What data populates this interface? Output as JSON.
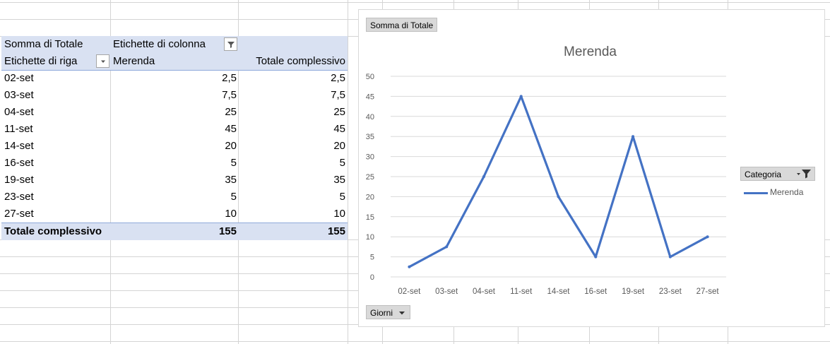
{
  "pivot": {
    "value_field": "Somma di Totale",
    "column_labels": "Etichette di colonna",
    "row_labels": "Etichette di riga",
    "series_header": "Merenda",
    "grand_total_header": "Totale complessivo",
    "rows": [
      {
        "label": "02-set",
        "merenda": "2,5",
        "total": "2,5"
      },
      {
        "label": "03-set",
        "merenda": "7,5",
        "total": "7,5"
      },
      {
        "label": "04-set",
        "merenda": "25",
        "total": "25"
      },
      {
        "label": "11-set",
        "merenda": "45",
        "total": "45"
      },
      {
        "label": "14-set",
        "merenda": "20",
        "total": "20"
      },
      {
        "label": "16-set",
        "merenda": "5",
        "total": "5"
      },
      {
        "label": "19-set",
        "merenda": "35",
        "total": "35"
      },
      {
        "label": "23-set",
        "merenda": "5",
        "total": "5"
      },
      {
        "label": "27-set",
        "merenda": "10",
        "total": "10"
      }
    ],
    "total_row": {
      "label": "Totale complessivo",
      "merenda": "155",
      "total": "155"
    }
  },
  "chart_controls": {
    "value_button": "Somma di Totale",
    "axis_button": "Giorni",
    "legend_button": "Categoria"
  },
  "chart_data": {
    "type": "line",
    "title": "Merenda",
    "categories": [
      "02-set",
      "03-set",
      "04-set",
      "11-set",
      "14-set",
      "16-set",
      "19-set",
      "23-set",
      "27-set"
    ],
    "series": [
      {
        "name": "Merenda",
        "values": [
          2.5,
          7.5,
          25,
          45,
          20,
          5,
          35,
          5,
          10
        ],
        "color": "#4472c4"
      }
    ],
    "ylim": [
      0,
      50
    ],
    "yticks": [
      "0",
      "5",
      "10",
      "15",
      "20",
      "25",
      "30",
      "35",
      "40",
      "45",
      "50"
    ],
    "grid": true,
    "legend": "right"
  },
  "colors": {
    "pivot_header": "#d9e1f2",
    "series_line": "#4472c4",
    "gridline": "#d9d9d9"
  }
}
